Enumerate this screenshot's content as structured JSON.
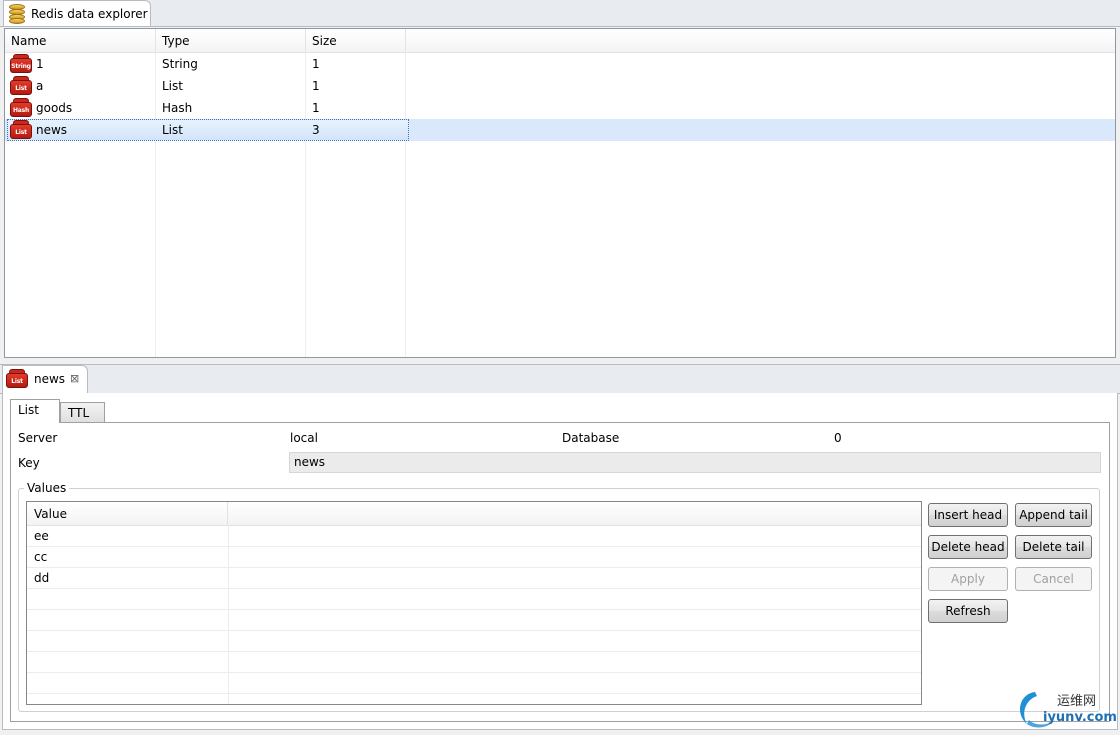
{
  "explorer": {
    "tab_title": "Redis data explorer",
    "columns": [
      "Name",
      "Type",
      "Size"
    ],
    "rows": [
      {
        "name": "1",
        "type": "String",
        "size": "1",
        "icon": "redis-string-icon",
        "icon_tag": "String"
      },
      {
        "name": "a",
        "type": "List",
        "size": "1",
        "icon": "redis-list-icon",
        "icon_tag": "List"
      },
      {
        "name": "goods",
        "type": "Hash",
        "size": "1",
        "icon": "redis-hash-icon",
        "icon_tag": "Hash"
      },
      {
        "name": "news",
        "type": "List",
        "size": "3",
        "icon": "redis-list-icon",
        "icon_tag": "List",
        "selected": true
      }
    ]
  },
  "editor": {
    "tab_title": "news",
    "tab_icon_tag": "List",
    "subtabs": [
      "List",
      "TTL"
    ],
    "active_subtab": "List",
    "server_label": "Server",
    "server_value": "local",
    "database_label": "Database",
    "database_value": "0",
    "key_label": "Key",
    "key_value": "news",
    "values_group_title": "Values",
    "values_header": "Value",
    "values": [
      "ee",
      "cc",
      "dd"
    ],
    "buttons": {
      "insert_head": "Insert head",
      "append_tail": "Append tail",
      "delete_head": "Delete head",
      "delete_tail": "Delete tail",
      "apply": "Apply",
      "cancel": "Cancel",
      "refresh": "Refresh"
    }
  },
  "watermark": {
    "cn": "运维网",
    "domain": "iyunv.com"
  },
  "colors": {
    "redis_red": "#c9281c",
    "selection": "#d9e8fb",
    "accent_blue": "#3b72c4"
  }
}
